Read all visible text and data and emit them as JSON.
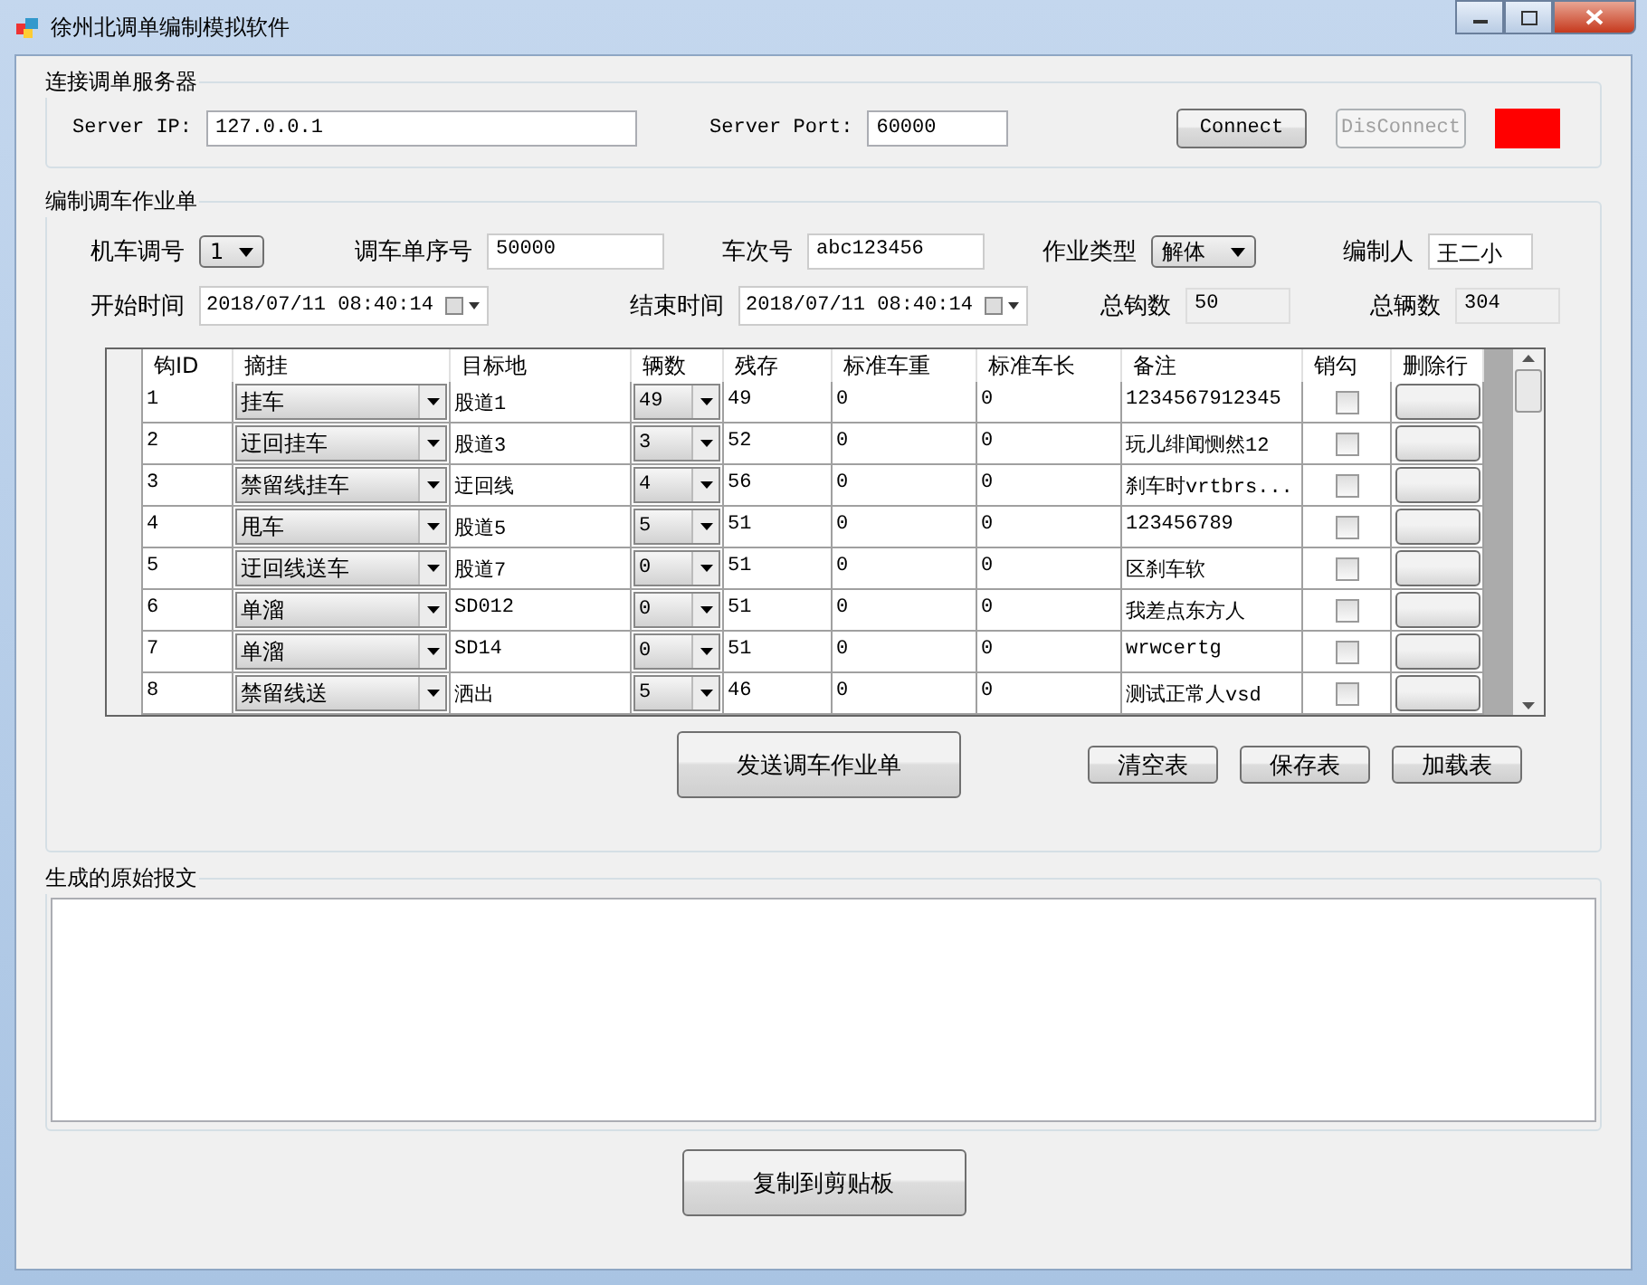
{
  "window": {
    "title": "徐州北调单编制模拟软件"
  },
  "connection": {
    "title": "连接调单服务器",
    "ip_label": "Server IP:",
    "ip_value": "127.0.0.1",
    "port_label": "Server Port:",
    "port_value": "60000",
    "connect_button": {
      "label": "Connect",
      "disabled": false
    },
    "disconnect_button": {
      "label": "DisConnect",
      "disabled": true
    },
    "connected": false
  },
  "job": {
    "title": "编制调车作业单",
    "fields_row1": [
      {
        "kind": "select",
        "label": "机车调号",
        "value": "1"
      },
      {
        "kind": "input",
        "label": "调车单序号",
        "value": "50000"
      },
      {
        "kind": "input",
        "label": "车次号",
        "value": "abc123456"
      },
      {
        "kind": "select",
        "label": "作业类型",
        "value": "解体"
      },
      {
        "kind": "input",
        "label": "编制人",
        "value": "王二小"
      }
    ],
    "fields_row2": [
      {
        "kind": "date",
        "label": "开始时间",
        "value": "2018/07/11 08:40:14"
      },
      {
        "kind": "date",
        "label": "结束时间",
        "value": "2018/07/11 08:40:14"
      },
      {
        "kind": "readonly",
        "label": "总钩数",
        "value": "50"
      },
      {
        "kind": "readonly",
        "label": "总辆数",
        "value": "304"
      }
    ],
    "table": {
      "columns": [
        "钩ID",
        "摘挂",
        "目标地",
        "辆数",
        "残存",
        "标准车重",
        "标准车长",
        "备注",
        "销勾",
        "删除行"
      ],
      "rows": [
        {
          "id": "1",
          "action": "挂车",
          "target": "股道1",
          "count": "49",
          "remain": "49",
          "weight": "0",
          "length": "0",
          "note": "1234567912345",
          "checked": false
        },
        {
          "id": "2",
          "action": "迂回挂车",
          "target": "股道3",
          "count": "3",
          "remain": "52",
          "weight": "0",
          "length": "0",
          "note": "玩儿绯闻恻然12",
          "checked": false
        },
        {
          "id": "3",
          "action": "禁留线挂车",
          "target": "迂回线",
          "count": "4",
          "remain": "56",
          "weight": "0",
          "length": "0",
          "note": "刹车时vrtbrs...",
          "checked": false
        },
        {
          "id": "4",
          "action": "甩车",
          "target": "股道5",
          "count": "5",
          "remain": "51",
          "weight": "0",
          "length": "0",
          "note": "123456789",
          "checked": false
        },
        {
          "id": "5",
          "action": "迂回线送车",
          "target": "股道7",
          "count": "0",
          "remain": "51",
          "weight": "0",
          "length": "0",
          "note": "区刹车软",
          "checked": false
        },
        {
          "id": "6",
          "action": "单溜",
          "target": "SD012",
          "count": "0",
          "remain": "51",
          "weight": "0",
          "length": "0",
          "note": "我差点东方人",
          "checked": false
        },
        {
          "id": "7",
          "action": "单溜",
          "target": "SD14",
          "count": "0",
          "remain": "51",
          "weight": "0",
          "length": "0",
          "note": "wrwcertg",
          "checked": false
        },
        {
          "id": "8",
          "action": "禁留线送",
          "target": "洒出",
          "count": "5",
          "remain": "46",
          "weight": "0",
          "length": "0",
          "note": "测试正常人vsd",
          "checked": false
        }
      ]
    },
    "send_button": "发送调车作业单",
    "table_buttons": [
      "清空表",
      "保存表",
      "加载表"
    ]
  },
  "output": {
    "title": "生成的原始报文"
  },
  "copy_button": "复制到剪贴板"
}
